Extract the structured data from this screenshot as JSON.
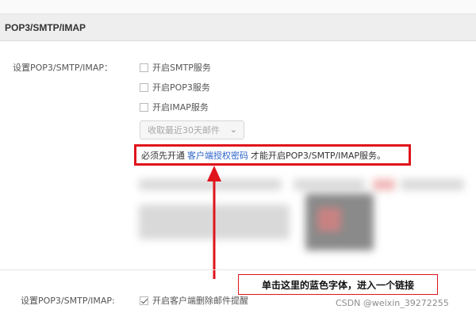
{
  "section": {
    "title": "POP3/SMTP/IMAP"
  },
  "settings": {
    "label": "设置POP3/SMTP/IMAP：",
    "options": [
      {
        "label": "开启SMTP服务",
        "checked": false
      },
      {
        "label": "开启POP3服务",
        "checked": false
      },
      {
        "label": "开启IMAP服务",
        "checked": false
      }
    ],
    "mail_range_select": {
      "value": "收取最近30天邮件",
      "icon": "chevron-down-icon"
    }
  },
  "notice": {
    "prefix": "必须先开通",
    "link": "客户端授权密码",
    "suffix": "才能开启POP3/SMTP/IMAP服务。"
  },
  "annotation": {
    "callout": "单击这里的蓝色字体，进入一个链接",
    "highlight_color": "#e0141c"
  },
  "bottom": {
    "label": "设置POP3/SMTP/IMAP:",
    "option": {
      "label": "开启客户端删除邮件提醒",
      "checked": true
    }
  },
  "watermark": "CSDN @weixin_39272255",
  "colors": {
    "link": "#2a62c9",
    "header_bg": "#eeeeee"
  }
}
